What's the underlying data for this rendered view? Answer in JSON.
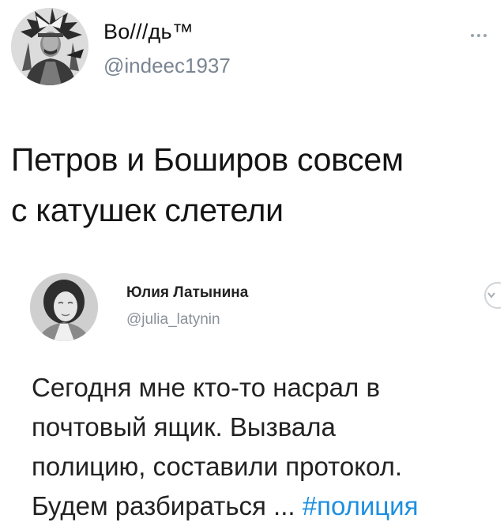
{
  "tweet": {
    "author": {
      "display_name": "Во///дь™",
      "handle": "@indeec1937",
      "avatar_icon": "avatar-portrait-headdress"
    },
    "more_icon": "more-horizontal-icon",
    "text_lines": [
      "Петров и Боширов совсем",
      "с катушек слетели"
    ]
  },
  "embedded_tweet": {
    "author": {
      "display_name": "Юлия Латынина",
      "handle": "@julia_latynin",
      "avatar_icon": "avatar-portrait-woman"
    },
    "chevron_icon": "chevron-down-icon",
    "text_lines": [
      "Сегодня мне кто-то насрал в",
      "почтовый ящик. Вызвала",
      "полицию, составили протокол.",
      "Будем разбираться ... "
    ],
    "hashtag": "#полиция",
    "colors": {
      "hashtag": "#1d8fe0",
      "handle": "#8a9199"
    }
  }
}
